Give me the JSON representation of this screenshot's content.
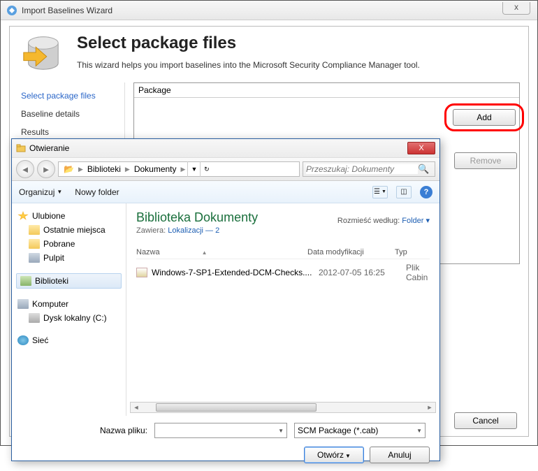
{
  "wizard": {
    "window_title": "Import Baselines Wizard",
    "close_glyph": "x",
    "heading": "Select package files",
    "subtitle": "This wizard helps you import baselines into the Microsoft Security Compliance Manager tool.",
    "steps": [
      "Select package files",
      "Baseline details",
      "Results"
    ],
    "package_label": "Package",
    "add_label": "Add",
    "remove_label": "Remove",
    "cancel_label": "Cancel"
  },
  "filedlg": {
    "title": "Otwieranie",
    "close_glyph": "X",
    "nav_back": "◄",
    "nav_fwd": "►",
    "crumb_root": "📂",
    "crumb_lib": "Biblioteki",
    "crumb_doc": "Dokumenty",
    "crumb_sep": "▶",
    "crumb_dd": "▼",
    "refresh": "↻",
    "search_placeholder": "Przeszukaj: Dokumenty",
    "toolbar_organize": "Organizuj",
    "toolbar_newfolder": "Nowy folder",
    "view_dd": "▼",
    "help_glyph": "?",
    "tree": {
      "fav": "Ulubione",
      "recent": "Ostatnie miejsca",
      "downloads": "Pobrane",
      "desktop": "Pulpit",
      "libraries": "Biblioteki",
      "computer": "Komputer",
      "localdisk": "Dysk lokalny (C:)",
      "network": "Sieć"
    },
    "list": {
      "lib_title": "Biblioteka Dokumenty",
      "contains_label": "Zawiera:",
      "contains_link": "Lokalizacji — 2",
      "arrange_label": "Rozmieść według:",
      "arrange_value": "Folder ▾",
      "col_name": "Nazwa",
      "col_date": "Data modyfikacji",
      "col_type": "Typ",
      "sort_glyph": "▲",
      "rows": [
        {
          "name": "Windows-7-SP1-Extended-DCM-Checks....",
          "date": "2012-07-05 16:25",
          "type": "Plik Cabin"
        }
      ]
    },
    "filename_label": "Nazwa pliku:",
    "filetype_value": "SCM Package (*.cab)",
    "open_label": "Otwórz",
    "cancel_label": "Anuluj",
    "dd_glyph": "▼"
  }
}
